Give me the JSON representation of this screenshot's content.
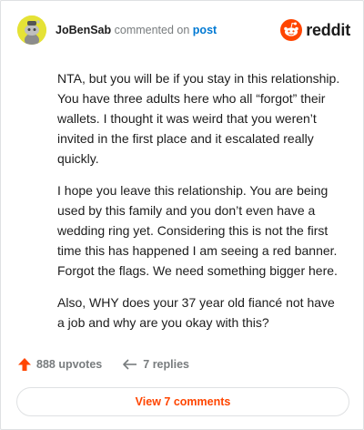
{
  "comment": {
    "username": "JoBenSab",
    "action_text": "commented on",
    "post_link": "post",
    "paragraphs": [
      "NTA, but you will be if you stay in this relationship. You have three adults here who all “forgot” their wallets. I thought it was weird that you weren’t invited in the first place and it escalated really quickly.",
      "I hope you leave this relationship. You are being used by this family and you don’t even have a wedding ring yet. Considering this is not the first time this has happened I am seeing a red banner. Forgot the flags. We need something bigger here.",
      "Also, WHY does your 37 year old fiancé not have a job and why are you okay with this?"
    ]
  },
  "brand": {
    "name": "reddit",
    "icon": "reddit-logo-icon",
    "color": "#ff4500"
  },
  "footer": {
    "upvotes": "888 upvotes",
    "replies": "7 replies",
    "upvote_icon": "upvote-arrow-icon",
    "reply_icon": "reply-arrow-icon",
    "upvote_color": "#ff4500"
  },
  "view_button": {
    "label": "View 7 comments",
    "color": "#ff4500"
  }
}
